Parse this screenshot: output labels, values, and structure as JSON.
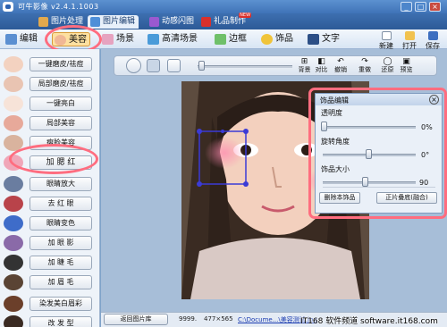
{
  "window": {
    "title": "可牛影像 v2.4.1.1003",
    "controls": [
      "_",
      "□",
      "×"
    ]
  },
  "tabs": [
    {
      "label": "图片处理",
      "icon": "photo-icon",
      "active": false
    },
    {
      "label": "图片编辑",
      "icon": "edit-picture-icon",
      "active": true
    },
    {
      "label": "动感闪图",
      "icon": "flash-icon",
      "active": false
    },
    {
      "label": "礼品制作",
      "icon": "gift-icon",
      "active": false,
      "badge": "NEW"
    }
  ],
  "toolbar": {
    "items": [
      {
        "label": "编辑",
        "icon": "edit-icon"
      },
      {
        "label": "美容",
        "icon": "face-icon",
        "active": true
      },
      {
        "label": "场景",
        "icon": "scene-icon"
      },
      {
        "label": "高清场景",
        "icon": "hd-scene-icon"
      },
      {
        "label": "边框",
        "icon": "frame-icon"
      },
      {
        "label": "饰品",
        "icon": "accessory-icon"
      },
      {
        "label": "文字",
        "icon": "text-icon"
      }
    ],
    "right": [
      {
        "label": "新建",
        "icon": "new-file-icon"
      },
      {
        "label": "打开",
        "icon": "folder-open-icon"
      },
      {
        "label": "保存",
        "icon": "save-icon"
      }
    ]
  },
  "left_panel": {
    "items": [
      {
        "label": "一键磨皮/祛痘",
        "icon": "smooth-skin-icon"
      },
      {
        "label": "局部磨皮/祛痘",
        "icon": "spot-smooth-icon"
      },
      {
        "label": "一键亮白",
        "icon": "whiten-icon"
      },
      {
        "label": "局部美容",
        "icon": "local-beauty-icon"
      },
      {
        "label": "瘦脸美容",
        "icon": "slim-face-icon"
      },
      {
        "label": "加 腮 红",
        "icon": "blush-icon",
        "highlighted": true
      },
      {
        "label": "眼睛放大",
        "icon": "eye-enlarge-icon"
      },
      {
        "label": "去 红 眼",
        "icon": "red-eye-icon"
      },
      {
        "label": "眼睛变色",
        "icon": "eye-color-icon"
      },
      {
        "label": "加 眼 影",
        "icon": "eye-shadow-icon"
      },
      {
        "label": "加 睫 毛",
        "icon": "eyelash-icon"
      },
      {
        "label": "加 眉 毛",
        "icon": "eyebrow-icon"
      },
      {
        "label": "染发美白眉彩",
        "icon": "hair-dye-icon"
      },
      {
        "label": "改 发 型",
        "icon": "hairstyle-icon"
      }
    ]
  },
  "sub_toolbar": {
    "buttons": [
      {
        "label": "背景",
        "glyph": "⊞"
      },
      {
        "label": "对比",
        "glyph": "◧"
      },
      {
        "label": "撤销",
        "glyph": "↶"
      },
      {
        "label": "重做",
        "glyph": "↷"
      },
      {
        "label": "还原",
        "glyph": "◯"
      },
      {
        "label": "预览",
        "glyph": "▣"
      }
    ]
  },
  "editor_panel": {
    "title": "饰品编辑",
    "transparency": {
      "label": "透明度",
      "value": "0%",
      "level": 0
    },
    "rotation": {
      "label": "旋转角度",
      "value": "0°",
      "level": 0.5
    },
    "size": {
      "label": "饰品大小",
      "value": "90",
      "level": 0.45
    },
    "delete_label": "删除本饰品",
    "overlay_label": "正片叠底(融合)"
  },
  "status_bar": {
    "back_label": "返回图片库",
    "zoom": "9999.",
    "dimensions": "477×565",
    "path": "C:\\Docume...\\美容测试.jpg"
  },
  "watermark": "IT168 软件频道 software.it168.com",
  "colors": {
    "accent": "#3f73b7",
    "highlight_ring": "#ff6d7f",
    "selection": "#3b3bd6",
    "blush": "#ff8ab0"
  }
}
